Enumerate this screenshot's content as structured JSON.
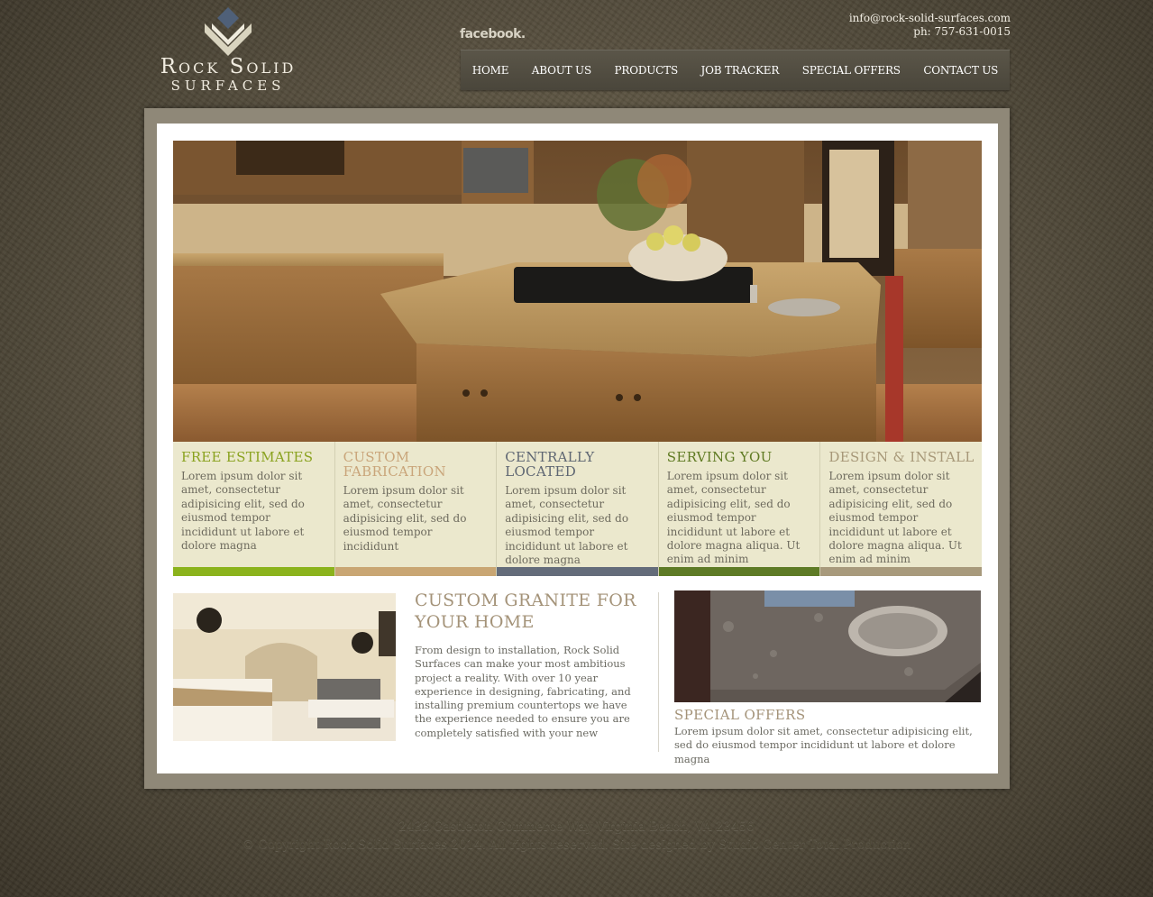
{
  "logo": {
    "line1": "Rock Solid",
    "line2": "Surfaces"
  },
  "facebook_label": "facebook.",
  "contact": {
    "email": "info@rock-solid-surfaces.com",
    "phone": "ph: 757-631-0015"
  },
  "nav": [
    "HOME",
    "ABOUT US",
    "PRODUCTS",
    "JOB TRACKER",
    "SPECIAL OFFERS",
    "CONTACT US"
  ],
  "features": [
    {
      "title": "FREE ESTIMATES",
      "text": "Lorem ipsum dolor sit amet, consectetur adipisicing elit, sed do eiusmod tempor incididunt ut labore et dolore magna",
      "title_color": "#8aa21f",
      "bar_color": "#8bb31c"
    },
    {
      "title": "CUSTOM FABRICATION",
      "text": "Lorem ipsum dolor sit amet, consectetur adipisicing elit, sed do eiusmod tempor incididunt",
      "title_color": "#c9a57a",
      "bar_color": "#c9a673"
    },
    {
      "title": "CENTRALLY LOCATED",
      "text": "Lorem ipsum dolor sit amet, consectetur adipisicing elit, sed do eiusmod tempor incididunt ut labore et dolore magna",
      "title_color": "#5e6672",
      "bar_color": "#646c7a"
    },
    {
      "title": "SERVING YOU",
      "text": "Lorem ipsum dolor sit amet, consectetur adipisicing elit, sed do eiusmod tempor incididunt ut labore et dolore magna aliqua. Ut enim ad minim",
      "title_color": "#5f7a22",
      "bar_color": "#5e7b26"
    },
    {
      "title": "DESIGN & INSTALL",
      "text": "Lorem ipsum dolor sit amet, consectetur adipisicing elit, sed do eiusmod tempor incididunt ut labore et dolore magna aliqua. Ut enim ad minim",
      "title_color": "#a79878",
      "bar_color": "#a89a7c"
    }
  ],
  "custom": {
    "title": "CUSTOM GRANITE FOR YOUR HOME",
    "text": "From design to installation, Rock Solid Surfaces can make your most ambitious project a reality.   With over 10 year experience in designing, fabricating, and installing premium countertops we have the experience needed to ensure you are completely satisfied with your new"
  },
  "special": {
    "title": "SPECIAL OFFERS",
    "text": "Lorem ipsum dolor sit amet, consectetur adipisicing elit, sed do eiusmod tempor incididunt ut labore et dolore magna"
  },
  "footer": {
    "address": "2433 Castleton Commerce Way Virginia Beach, VA 23456",
    "copyright": "© Copyright Rock Solid Surfaces 2014. All rights reserved. Site designed by Studio Center Total Production"
  }
}
